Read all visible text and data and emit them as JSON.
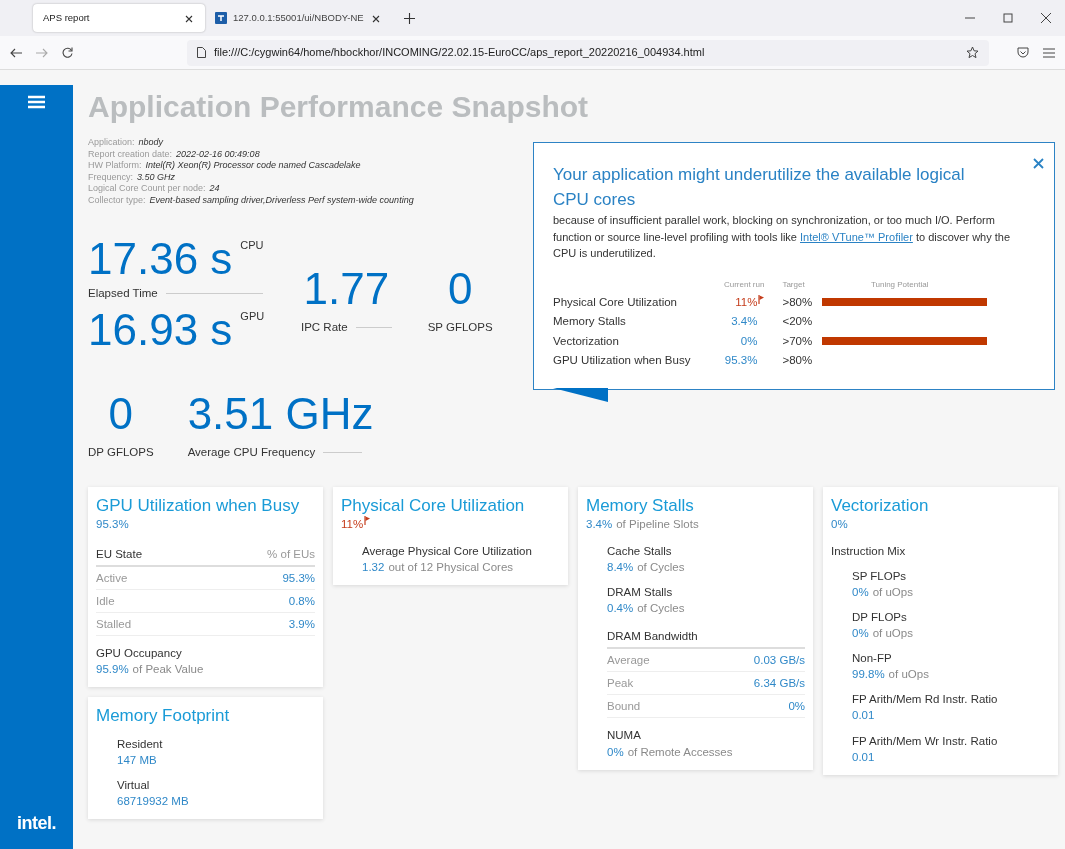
{
  "browser": {
    "tabs": [
      {
        "title": "APS report",
        "selected": true,
        "favicon": false
      },
      {
        "title": "127.0.0.1:55001/ui/NBODY-NE",
        "selected": false,
        "favicon": true
      }
    ],
    "url": "file:///C:/cygwin64/home/hbockhor/INCOMING/22.02.15-EuroCC/aps_report_20220216_004934.html"
  },
  "sidebar": {
    "logo": "intel."
  },
  "title": "Application Performance Snapshot",
  "info": [
    {
      "label": "Application:",
      "value": "nbody"
    },
    {
      "label": "Report creation date:",
      "value": "2022-02-16 00:49:08"
    },
    {
      "label": "HW Platform:",
      "value": "Intel(R) Xeon(R) Processor code named Cascadelake"
    },
    {
      "label": "Frequency:",
      "value": "3.50 GHz"
    },
    {
      "label": "Logical Core Count per node:",
      "value": "24"
    },
    {
      "label": "Collector type:",
      "value": "Event-based sampling driver,Driverless Perf system-wide counting"
    }
  ],
  "metrics": {
    "elapsed": {
      "cpu_value": "17.36 s",
      "cpu_tag": "CPU",
      "label": "Elapsed Time",
      "gpu_value": "16.93 s",
      "gpu_tag": "GPU"
    },
    "ipc": {
      "value": "1.77",
      "label": "IPC Rate"
    },
    "sp": {
      "value": "0",
      "label": "SP GFLOPS"
    },
    "dp": {
      "value": "0",
      "label": "DP GFLOPS"
    },
    "freq": {
      "value": "3.51 GHz",
      "label": "Average CPU Frequency"
    }
  },
  "popover": {
    "title": "Your application might underutilize the available logical CPU cores",
    "body_before": "because of insufficient parallel work, blocking on synchronization, or too much I/O. Perform function or source line-level profiling with tools like ",
    "link": "Intel® VTune™ Profiler",
    "body_after": " to discover why the CPU is underutilized.",
    "headers": [
      "Current run",
      "Target",
      "Tuning Potential"
    ],
    "rows": [
      {
        "name": "Physical Core Utilization",
        "current": "11%",
        "flagged": true,
        "target": ">80%",
        "tuning_potential": true
      },
      {
        "name": "Memory Stalls",
        "current": "3.4%",
        "flagged": false,
        "target": "<20%",
        "tuning_potential": false
      },
      {
        "name": "Vectorization",
        "current": "0%",
        "flagged": false,
        "target": ">70%",
        "tuning_potential": true
      },
      {
        "name": "GPU Utilization when Busy",
        "current": "95.3%",
        "flagged": false,
        "target": ">80%",
        "tuning_potential": false
      }
    ]
  },
  "card_columns": [
    {
      "cards": [
        {
          "title": "GPU Utilization when Busy",
          "value": "95.3%",
          "flagged": false,
          "items": [
            {
              "kind": "table",
              "headers": [
                "EU State",
                "% of EUs"
              ],
              "rows": [
                {
                  "label": "Active",
                  "value": "95.3%"
                },
                {
                  "label": "Idle",
                  "value": "0.8%"
                },
                {
                  "label": "Stalled",
                  "value": "3.9%"
                }
              ]
            },
            {
              "kind": "metric",
              "label": "GPU Occupancy",
              "value": "95.9%",
              "unit": "of Peak Value",
              "indented": false
            }
          ]
        },
        {
          "title": "Memory Footprint",
          "items": [
            {
              "kind": "metric",
              "label": "Resident",
              "value": "147 MB",
              "indented": true
            },
            {
              "kind": "metric",
              "label": "Virtual",
              "value": "68719932 MB",
              "indented": true
            }
          ]
        }
      ]
    },
    {
      "cards": [
        {
          "title": "Physical Core Utilization",
          "value": "11%",
          "flagged": true,
          "items": [
            {
              "kind": "metric",
              "label": "Average Physical Core Utilization",
              "value": "1.32",
              "unit": "out of 12 Physical Cores",
              "indented": true
            }
          ]
        }
      ]
    },
    {
      "cards": [
        {
          "title": "Memory Stalls",
          "value": "3.4%",
          "unit": "of Pipeline Slots",
          "flagged": false,
          "items": [
            {
              "kind": "metric",
              "label": "Cache Stalls",
              "value": "8.4%",
              "unit": "of Cycles",
              "indented": true
            },
            {
              "kind": "metric",
              "label": "DRAM Stalls",
              "value": "0.4%",
              "unit": "of Cycles",
              "indented": true
            },
            {
              "kind": "titled_table",
              "headers": [
                "DRAM Bandwidth"
              ],
              "rows": [
                {
                  "label": "Average",
                  "value": "0.03 GB/s"
                },
                {
                  "label": "Peak",
                  "value": "6.34 GB/s"
                },
                {
                  "label": "Bound",
                  "value": "0%"
                }
              ]
            },
            {
              "kind": "metric",
              "label": "NUMA",
              "value": "0%",
              "unit": "of Remote Accesses",
              "indented": true
            }
          ]
        }
      ]
    },
    {
      "cards": [
        {
          "title": "Vectorization",
          "value": "0%",
          "flagged": false,
          "items": [
            {
              "kind": "heading",
              "label": "Instruction Mix"
            },
            {
              "kind": "metric",
              "label": "SP FLOPs",
              "value": "0%",
              "unit": "of uOps",
              "indented": true
            },
            {
              "kind": "metric",
              "label": "DP FLOPs",
              "value": "0%",
              "unit": "of uOps",
              "indented": true
            },
            {
              "kind": "metric",
              "label": "Non-FP",
              "value": "99.8%",
              "unit": "of uOps",
              "indented": true
            },
            {
              "kind": "metric",
              "label": "FP Arith/Mem Rd Instr. Ratio",
              "value": "0.01",
              "indented": true
            },
            {
              "kind": "metric",
              "label": "FP Arith/Mem Wr Instr. Ratio",
              "value": "0.01",
              "indented": true
            }
          ]
        }
      ]
    }
  ]
}
